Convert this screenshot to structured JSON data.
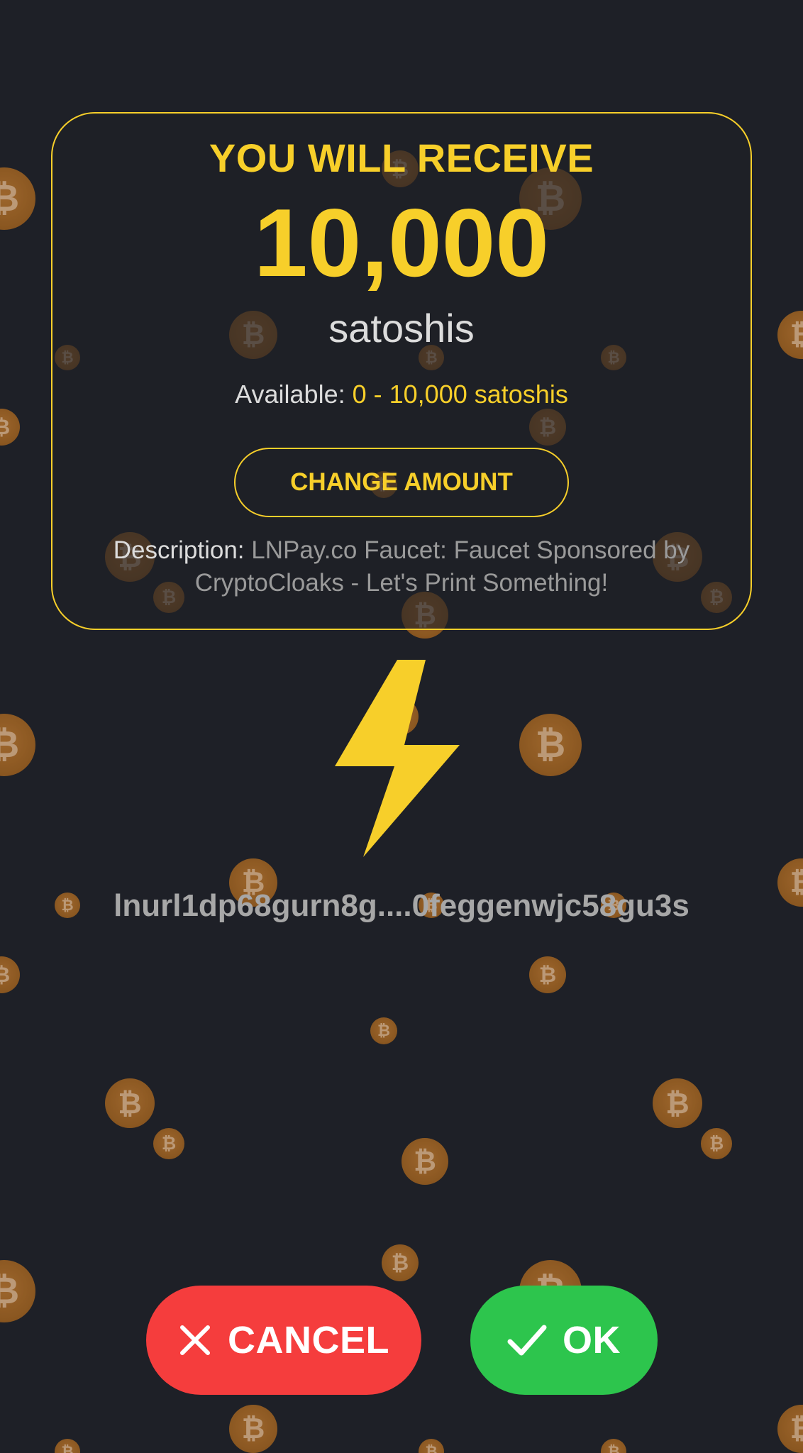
{
  "receive": {
    "title": "YOU WILL RECEIVE",
    "amount": "10,000",
    "unit": "satoshis"
  },
  "available": {
    "label": "Available:",
    "range": "0 - 10,000 satoshis"
  },
  "change_amount_label": "CHANGE AMOUNT",
  "description": {
    "label": "Description:",
    "value": "LNPay.co Faucet: Faucet Sponsored by CryptoCloaks - Let's Print Something!"
  },
  "lnurl": "lnurl1dp68gurn8g....0feggenwjc58gu3s",
  "actions": {
    "cancel_label": "CANCEL",
    "ok_label": "OK"
  },
  "icons": {
    "bolt": "lightning-bolt-icon",
    "cancel": "close-icon",
    "ok": "checkmark-icon",
    "coin": "bitcoin-coin-icon"
  },
  "colors": {
    "background": "#1e2027",
    "accent": "#f7cf2a",
    "cancel": "#f53d3d",
    "ok": "#2dc54d",
    "coin": "#c17a2e"
  }
}
